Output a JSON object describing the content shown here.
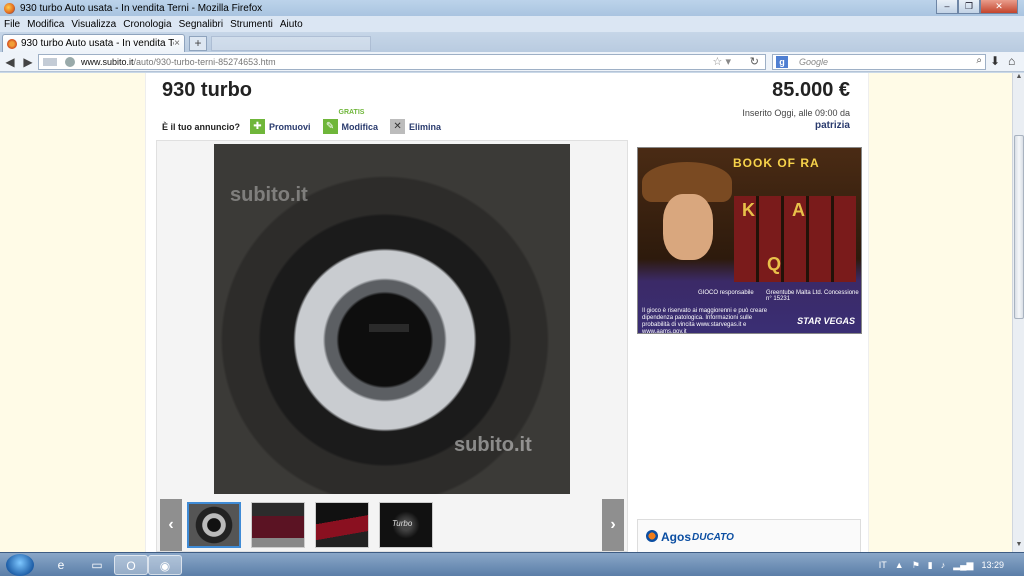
{
  "window": {
    "title": "930 turbo Auto usata - In vendita Terni - Mozilla Firefox",
    "controls": {
      "minimize": "–",
      "restore": "❐",
      "close": "✕"
    }
  },
  "menu": [
    "File",
    "Modifica",
    "Visualizza",
    "Cronologia",
    "Segnalibri",
    "Strumenti",
    "Aiuto"
  ],
  "tab": {
    "label": "930 turbo Auto usata - In vendita Terni",
    "close": "×",
    "new_tab": "+"
  },
  "address": {
    "domain": "www.subito.it",
    "path": "/auto/930-turbo-terni-85274653.htm"
  },
  "search": {
    "engine_icon": "g",
    "placeholder": "Google"
  },
  "ad": {
    "title": "930 turbo",
    "price": "85.000 €",
    "posted": "Inserito Oggi, alle 09:00 da",
    "seller": "patrizia",
    "owner_question": "È il tuo annuncio?",
    "actions": {
      "promote": "Promuovi",
      "edit": "Modifica",
      "edit_badge": "GRATIS",
      "delete": "Elimina"
    },
    "watermark": "subito.it",
    "thumb4_text": "Turbo"
  },
  "banner1": {
    "logo": "BOOK OF RA",
    "reel_symbols": [
      "K",
      "A",
      "Q"
    ],
    "gioco_info": "GIOCO responsabile",
    "concession": "Greentube Malta Ltd. Concessione n° 15231",
    "disclaimer": "Il gioco è riservato ai maggiorenni e può creare dipendenza patologica. Informazioni sulle probabilità di vincita www.starvegas.it e www.aams.gov.it",
    "brand": "STAR VEGAS"
  },
  "banner2": {
    "brand": "Agos",
    "partner": "DUCATO"
  },
  "taskbar": {
    "lang": "IT",
    "clock": "13:29"
  },
  "colors": {
    "accent": "#2a3b6e",
    "green_action": "#6fb63a",
    "page_bg": "#fffbe7"
  }
}
